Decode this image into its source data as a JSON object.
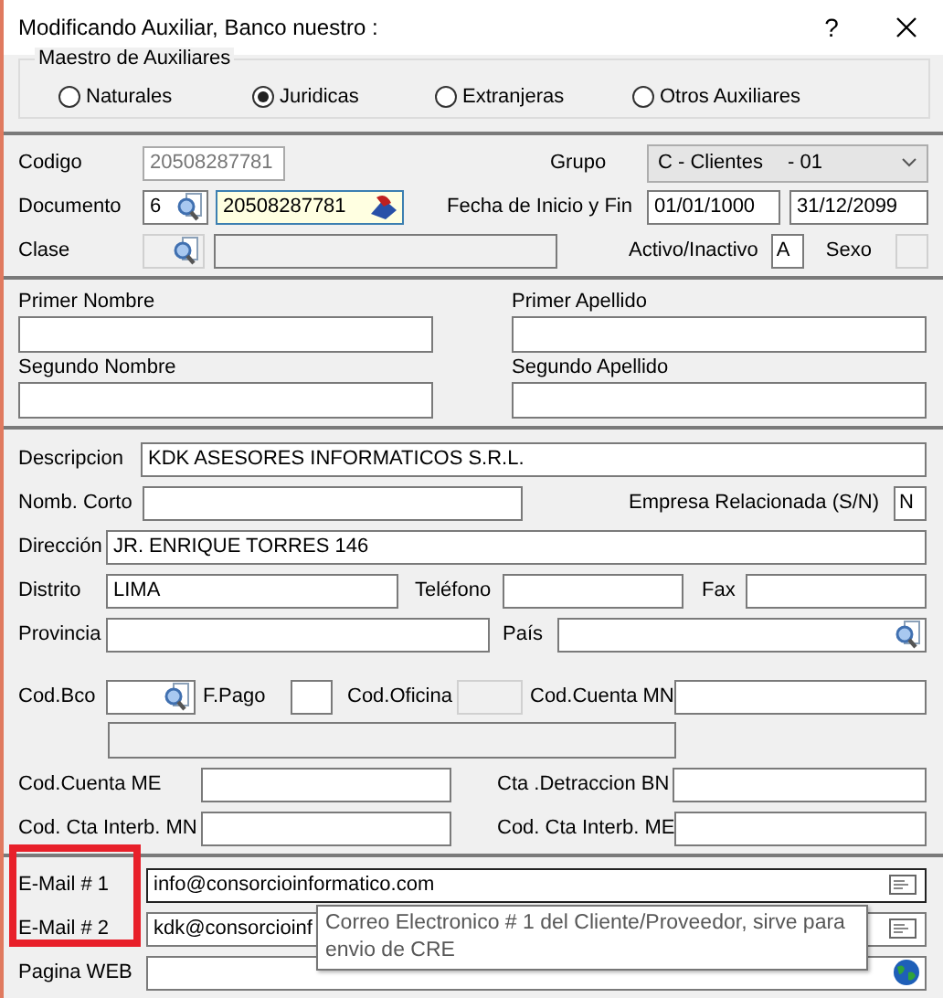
{
  "window": {
    "title": "Modificando Auxiliar, Banco nuestro :",
    "help": "?"
  },
  "maestro": {
    "title": "Maestro de Auxiliares",
    "options": [
      {
        "label": "Naturales",
        "selected": false
      },
      {
        "label": "Juridicas",
        "selected": true
      },
      {
        "label": "Extranjeras",
        "selected": false
      },
      {
        "label": "Otros Auxiliares",
        "selected": false
      }
    ]
  },
  "codigo": {
    "label": "Codigo",
    "value": "20508287781"
  },
  "grupo": {
    "label": "Grupo",
    "value": "C - Clientes",
    "suffix": "- 01"
  },
  "documento": {
    "label": "Documento",
    "type": "6",
    "value": "20508287781"
  },
  "fechas": {
    "label": "Fecha de Inicio y Fin",
    "start": "01/01/1000",
    "end": "31/12/2099"
  },
  "clase": {
    "label": "Clase"
  },
  "activo": {
    "label": "Activo/Inactivo",
    "value": "A"
  },
  "sexo": {
    "label": "Sexo"
  },
  "names": [
    {
      "label": "Primer Nombre"
    },
    {
      "label": "Primer Apellido"
    },
    {
      "label": "Segundo Nombre"
    },
    {
      "label": "Segundo Apellido"
    }
  ],
  "descripcion": {
    "label": "Descripcion",
    "value": "KDK ASESORES INFORMATICOS S.R.L."
  },
  "nombre_corto": {
    "label": "Nomb. Corto"
  },
  "empresa_relacionada": {
    "label": "Empresa Relacionada (S/N)",
    "value": "N"
  },
  "direccion": {
    "label": "Dirección",
    "value": "JR. ENRIQUE TORRES 146"
  },
  "distrito": {
    "label": "Distrito",
    "value": "LIMA"
  },
  "telefono": {
    "label": "Teléfono"
  },
  "fax": {
    "label": "Fax"
  },
  "provincia": {
    "label": "Provincia"
  },
  "pais": {
    "label": "País"
  },
  "cod_bco": {
    "label": "Cod.Bco"
  },
  "f_pago": {
    "label": "F.Pago"
  },
  "cod_oficina": {
    "label": "Cod.Oficina"
  },
  "cod_cuenta_mn": {
    "label": "Cod.Cuenta MN"
  },
  "cod_cuenta_me": {
    "label": "Cod.Cuenta ME"
  },
  "cta_detraccion": {
    "label": "Cta .Detraccion BN"
  },
  "interb_mn": {
    "label": "Cod. Cta Interb. MN"
  },
  "interb_me": {
    "label": "Cod. Cta Interb. ME"
  },
  "email1": {
    "label": "E-Mail  # 1",
    "value": "info@consorcioinformatico.com"
  },
  "email2": {
    "label": "E-Mail  # 2",
    "value": "kdk@consorcioinf"
  },
  "web": {
    "label": "Pagina WEB"
  },
  "tooltip": "Correo Electronico # 1 del Cliente/Proveedor, sirve para envio de CRE"
}
